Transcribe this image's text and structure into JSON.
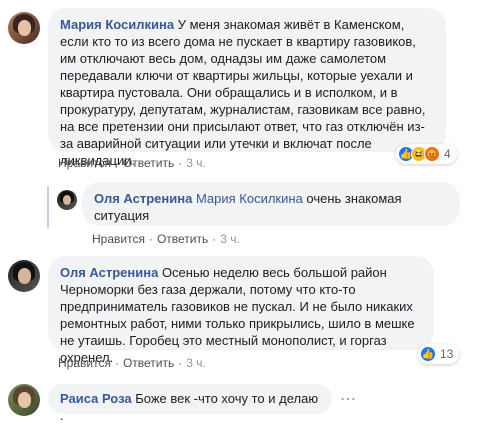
{
  "comments": [
    {
      "author": "Мария Косилкина",
      "text": "У меня знакомая живёт в Каменском, если кто то из всего дома не пускает в квартиру газовиков, им отключают весь дом, однадзы им даже самолетом передавали ключи от квартиры жильцы, которые уехали и квартира пустовала. Они обращались и в исполком, и в прокуратуру, депутатам, журналистам, газовикам все равно, на все претензии они присылают ответ, что газ отключён из-за аварийной ситуации или утечки и включат после ликвидации.",
      "like": "Нравится",
      "reply": "Ответить",
      "time": "3 ч.",
      "reactions": {
        "icons": [
          "like-icon",
          "haha-icon",
          "angry-icon"
        ],
        "count": "4"
      }
    },
    {
      "author": "Оля Астренина",
      "mention": "Мария Косилкина",
      "text": "очень знакомая ситуация",
      "like": "Нравится",
      "reply": "Ответить",
      "time": "3 ч."
    },
    {
      "author": "Оля Астренина",
      "text": "Осенью неделю весь большой район Черноморки без газа держали, потому что кто-то предприниматель газовиков не пускал. И не было никаких ремонтных работ, ними только прикрылись, шило в мешке не утаишь. Горобец это местный монополист, и горгаз охренел.",
      "like": "Нравится",
      "reply": "Ответить",
      "time": "3 ч.",
      "reactions": {
        "icons": [
          "like-icon"
        ],
        "count": "13"
      }
    },
    {
      "author": "Раиса Роза",
      "text": "Боже век -что хочу то и делаю ."
    }
  ],
  "icons": {
    "more": "more-options-icon"
  },
  "colors": {
    "author": "#385898",
    "bubble": "#f2f3f5",
    "like": "#1877f2"
  }
}
